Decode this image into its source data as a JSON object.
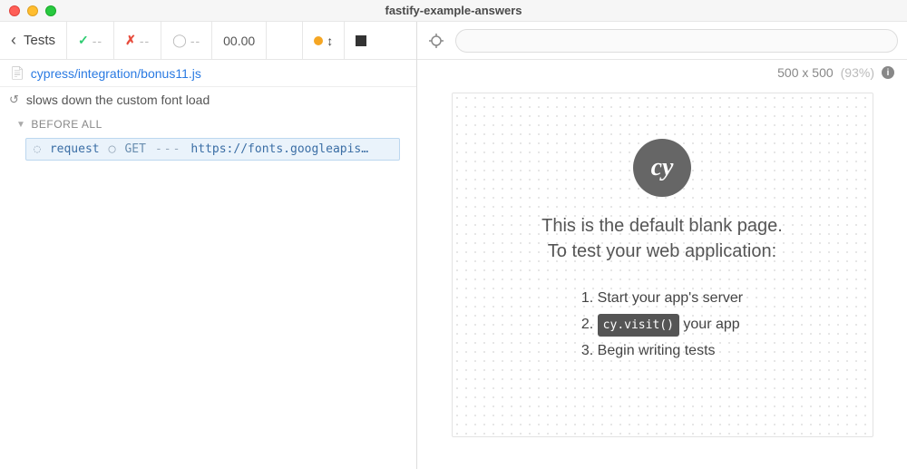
{
  "window": {
    "title": "fastify-example-answers"
  },
  "toolbar": {
    "back_label": "Tests",
    "pass_count": "--",
    "fail_count": "--",
    "pending_count": "--",
    "timer": "00.00"
  },
  "file": {
    "path": "cypress/integration/bonus11.js"
  },
  "spec": {
    "test_title": "slows down the custom font load",
    "hooks": [
      {
        "name": "BEFORE ALL",
        "commands": [
          {
            "name": "request",
            "method": "GET",
            "dashes": "---",
            "url": "https://fonts.googleapis…"
          }
        ]
      }
    ]
  },
  "preview": {
    "viewport": "500 x 500",
    "scale": "(93%)",
    "logo_text": "cy",
    "heading_line1": "This is the default blank page.",
    "heading_line2": "To test your web application:",
    "steps": {
      "s1": "Start your app's server",
      "s2a": "cy.visit()",
      "s2b": " your app",
      "s3": "Begin writing tests"
    }
  }
}
